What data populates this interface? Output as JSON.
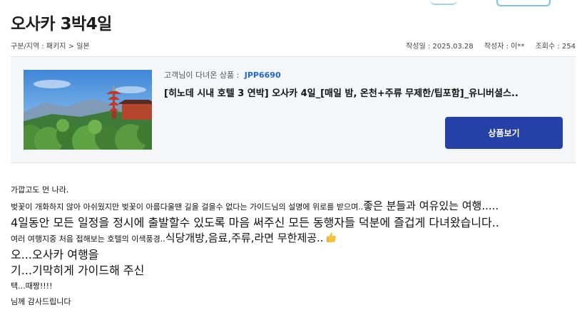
{
  "page": {
    "title": "오사카 3박4일"
  },
  "meta": {
    "breadcrumb": "구분/지역 : 패키지 > 일본",
    "date": "작성일 : 2025.03.28",
    "author": "작성자 : 이**",
    "views": "조회수 : 254"
  },
  "product": {
    "label": "고객님이 다녀온 상품 :",
    "code": "JPP6690",
    "name": "[히노데 시내 호텔 3 연박] 오사카 4일_[매일 밤, 온천+주류 무제한/팁포함]_유니버셜스..",
    "button_label": "상품보기",
    "image_icon": "kiyomizu-pagoda-photo"
  },
  "review": {
    "line1": "가깝고도 먼 나라.",
    "line2_small": "벚꽃이 개화하지 않아 아쉬웠지만 벚꽃이 아름다울땐 길을 걸을수 없다는 가이드님의 설명에 위로를 받으며..",
    "line2_large": "좋은 분들과 여유있는 여행.....",
    "line3": "4일동안 모든 일정을 정시에 출발할수 있도록 마음 써주신 모든 동행자들 덕분에 즐겁게 다녀왔습니다..",
    "line4_small": "여러 여행지중 처음 접해보는 호텔의 이색풍경..",
    "line4_large": "식당개방,음료,주류,라면 무한제공..",
    "line4_icon": "thumbs-up-icon",
    "line5": "오...오사카 여행을",
    "line6": "기...기막히게 가이드해 주신",
    "line7": "택...때짱!!!!",
    "line8": "님께 감사드립니다"
  },
  "colors": {
    "accent": "#2540a6",
    "code": "#1f66d6",
    "panel": "#f5f6f8"
  }
}
